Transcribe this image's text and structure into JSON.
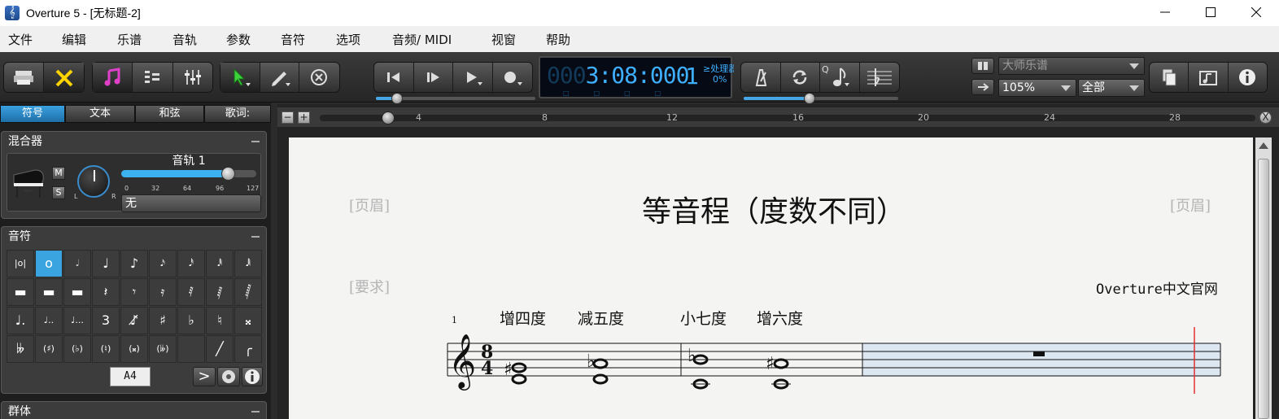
{
  "window": {
    "title": "Overture 5 - [无标题-2]",
    "controls": [
      "minimize-icon",
      "maximize-icon",
      "close-icon"
    ]
  },
  "menu": [
    "文件",
    "编辑",
    "乐谱",
    "音轨",
    "参数",
    "音符",
    "选项",
    "音频/ MIDI",
    "视窗",
    "帮助"
  ],
  "toolbar": {
    "transport_time": {
      "prefix_dim": "000",
      "time": "3:08:000",
      "bar": "1"
    },
    "processing_label": "≥处理器",
    "processing_value": "0%",
    "display_mode_select": "大师乐谱",
    "zoom_select": "105%",
    "range_select": "全部",
    "note_duration_label": "Q"
  },
  "left_panel": {
    "tabs": [
      "符号",
      "文本",
      "和弦",
      "歌词:"
    ],
    "active_tab": "符号",
    "mixer": {
      "title": "混合器",
      "track_name": "音轨  1",
      "mute": "M",
      "solo": "S",
      "pan_left": "L",
      "pan_right": "R",
      "volume_ticks": [
        "0",
        "32",
        "64",
        "96",
        "127"
      ],
      "volume_value": 100,
      "instrument": "无"
    },
    "notes": {
      "title": "音符",
      "octave_value": "A4",
      "accent_label": ">",
      "info_label": "i"
    },
    "groups_title": "群体"
  },
  "ruler": {
    "marks": [
      "4",
      "8",
      "12",
      "16",
      "20",
      "24",
      "28"
    ],
    "minus": "−",
    "plus": "+",
    "close": "X"
  },
  "score": {
    "header_left": "[页眉]",
    "header_right": "[页眉]",
    "title": "等音程（度数不同）",
    "requirements": "[要求]",
    "composer": "Overture中文官网",
    "measure_number": "1",
    "time_signature": {
      "top": "8",
      "bottom": "4"
    },
    "interval_labels": [
      "增四度",
      "减五度",
      "小七度",
      "增六度"
    ]
  }
}
